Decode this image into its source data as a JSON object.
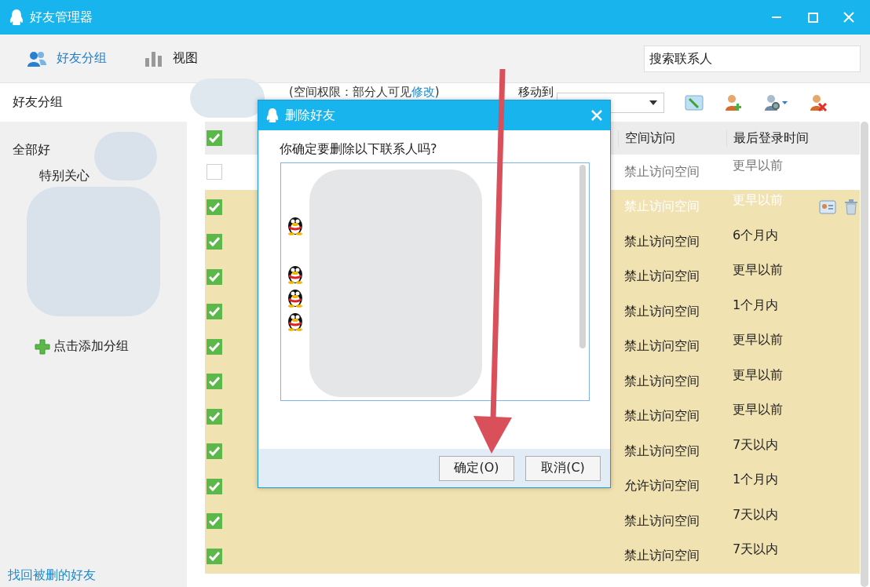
{
  "window": {
    "title": "好友管理器"
  },
  "toolbar_tabs": [
    {
      "label": "好友分组",
      "selected": true
    },
    {
      "label": "视图",
      "selected": false
    }
  ],
  "search": {
    "placeholder": "搜索联系人"
  },
  "sidebar": {
    "header": "好友分组",
    "groups": [
      {
        "label": "全部好",
        "kind": "root"
      },
      {
        "label": "特别关心",
        "kind": "child"
      }
    ],
    "add_group": "点击添加分组",
    "recover_link": "找回被删的好友"
  },
  "permission": {
    "text": "(空间权限：部分人可见",
    "link": "修改",
    "close": ")"
  },
  "move_to": {
    "label": "移动到"
  },
  "table": {
    "header_checked": true,
    "columns": [
      "空间访问",
      "最后登录时间"
    ],
    "rows": [
      {
        "checked": false,
        "hovered": false,
        "access": "禁止访问空间",
        "last_login": "更早以前"
      },
      {
        "checked": true,
        "hovered": true,
        "access": "禁止访问空间",
        "last_login": "更早以前"
      },
      {
        "checked": true,
        "hovered": false,
        "access": "禁止访问空间",
        "last_login": "6个月内"
      },
      {
        "checked": true,
        "hovered": false,
        "access": "禁止访问空间",
        "last_login": "更早以前"
      },
      {
        "checked": true,
        "hovered": false,
        "access": "禁止访问空间",
        "last_login": "1个月内"
      },
      {
        "checked": true,
        "hovered": false,
        "access": "禁止访问空间",
        "last_login": "更早以前"
      },
      {
        "checked": true,
        "hovered": false,
        "access": "禁止访问空间",
        "last_login": "更早以前"
      },
      {
        "checked": true,
        "hovered": false,
        "access": "禁止访问空间",
        "last_login": "更早以前"
      },
      {
        "checked": true,
        "hovered": false,
        "access": "禁止访问空间",
        "last_login": "7天以内"
      },
      {
        "checked": true,
        "hovered": false,
        "access": "允许访问空间",
        "last_login": "1个月内"
      },
      {
        "checked": true,
        "hovered": false,
        "access": "禁止访问空间",
        "last_login": "7天以内"
      },
      {
        "checked": true,
        "hovered": false,
        "access": "禁止访问空间",
        "last_login": "7天以内"
      }
    ]
  },
  "dialog": {
    "title": "删除好友",
    "question": "你确定要删除以下联系人吗?",
    "buttons": [
      "确定(O)",
      "取消(C)"
    ]
  }
}
